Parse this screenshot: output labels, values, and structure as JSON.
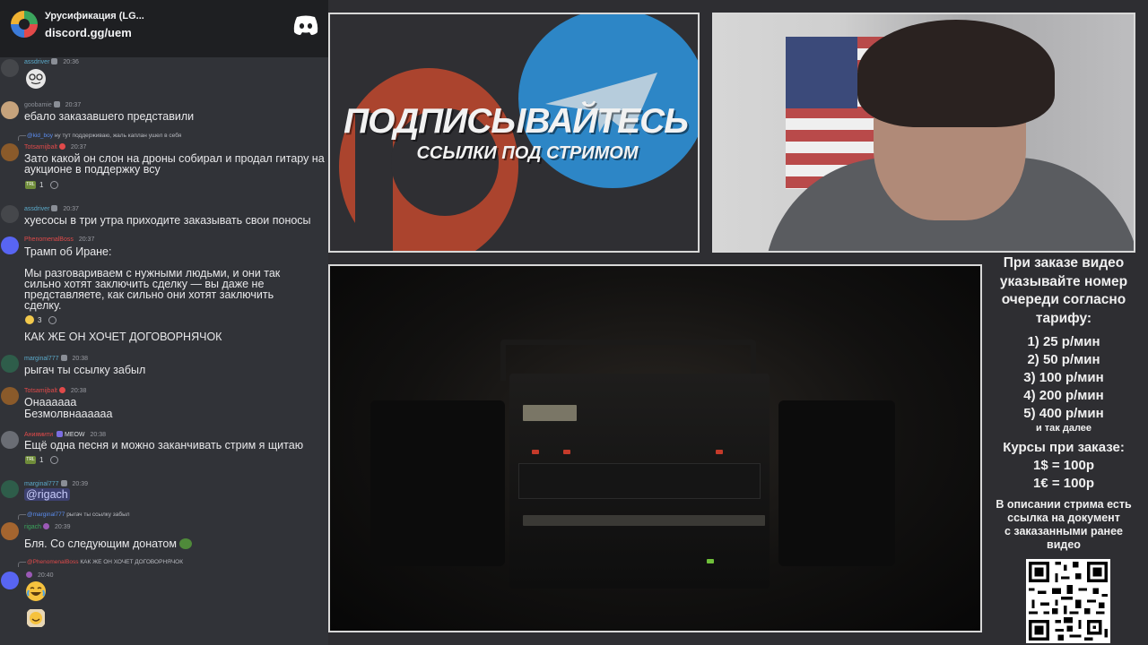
{
  "server": {
    "name": "Урусификация (LG...",
    "invite": "discord.gg/uem"
  },
  "messages": [
    {
      "user": "assdriver",
      "time": "20:36"
    },
    {
      "user": "goobamie",
      "time": "20:37",
      "text": "ебало заказавшего представили"
    },
    {
      "reply_user": "@kid_boy",
      "reply_text": "ну тут поддерживаю, жаль каплан ушел в себя",
      "user": "Totsamijbalt",
      "time": "20:37",
      "text": "Зато какой он слон на дроны собирал и продал гитару на аукционе в поддержку всу",
      "reaction_count": "1"
    },
    {
      "user": "assdriver",
      "time": "20:37",
      "text": "хуесосы в три утра приходите заказывать свои поносы"
    },
    {
      "user": "PhenomenalBoss",
      "time": "20:37",
      "text": "Трамп об Иране:",
      "quote": "Мы разговариваем с нужными людьми, и они так сильно хотят заключить сделку — вы даже не представляете, как сильно они хотят заключить сделку.",
      "reaction_count": "3",
      "text2": "КАК ЖЕ ОН ХОЧЕТ ДОГОВОРНЯЧОК"
    },
    {
      "user": "marginal777",
      "time": "20:38",
      "text": "рыгач ты ссылку забыл"
    },
    {
      "user": "Totsamijbalt",
      "time": "20:38",
      "text": "Онаааааа",
      "text2": "Безмолвнаааааа"
    },
    {
      "user": "Аниямити",
      "tag": "MEOW",
      "time": "20:38",
      "text": "Ещё одна песня и можно заканчивать стрим я щитаю",
      "reaction_count": "1"
    },
    {
      "user": "marginal777",
      "time": "20:39",
      "mention": "@rigach"
    },
    {
      "reply_user": "@marginal777",
      "reply_text": "рыгач ты ссылку забыл",
      "user": "rigach",
      "time": "20:39",
      "text": "Бля. Со следующим донатом"
    },
    {
      "reply_user": "@PhenomenalBoss",
      "reply_text": "КАК ЖЕ ОН ХОЧЕТ ДОГОВОРНЯЧОК",
      "time": "20:40"
    }
  ],
  "promo": {
    "title": "ПОДПИСЫВАЙТЕСЬ",
    "subtitle": "ССЫЛКИ ПОД СТРИМОМ"
  },
  "info": {
    "heading": [
      "При заказе видео",
      "указывайте номер",
      "очереди согласно",
      "тарифу:"
    ],
    "tariffs": [
      "1) 25 р/мин",
      "2) 50 р/мин",
      "3) 100 р/мин",
      "4) 200 р/мин",
      "5) 400 р/мин"
    ],
    "etc": "и так далее",
    "rates_heading": "Курсы при заказе:",
    "rates": [
      "1$ = 100р",
      "1€ = 100р"
    ],
    "footer": [
      "В описании стрима есть",
      "ссылка на документ",
      "с заказанными ранее",
      "видео"
    ]
  },
  "colors": {
    "patreon": "#b9472e",
    "telegram": "#2d86c6",
    "chat_bg": "#313338",
    "border": "#d8d8d8"
  }
}
